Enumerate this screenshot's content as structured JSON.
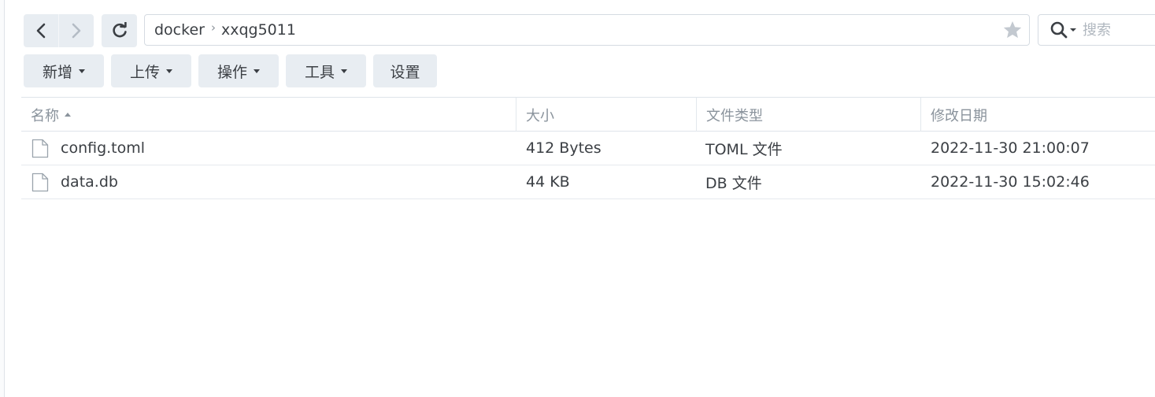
{
  "path": {
    "folder": "docker",
    "subfolder": "xxqg5011"
  },
  "search": {
    "placeholder": "搜索"
  },
  "toolbar": {
    "create": "新增",
    "upload": "上传",
    "action": "操作",
    "tools": "工具",
    "settings": "设置"
  },
  "columns": {
    "name": "名称",
    "size": "大小",
    "type": "文件类型",
    "modified": "修改日期"
  },
  "files": [
    {
      "name": "config.toml",
      "size": "412 Bytes",
      "type": "TOML 文件",
      "modified": "2022-11-30 21:00:07"
    },
    {
      "name": "data.db",
      "size": "44 KB",
      "type": "DB 文件",
      "modified": "2022-11-30 15:02:46"
    }
  ],
  "icons": {
    "back": "chevron-left-icon",
    "forward": "chevron-right-icon",
    "refresh": "refresh-icon",
    "favorite": "star-icon",
    "search": "search-icon",
    "file": "file-icon"
  },
  "colors": {
    "button_bg": "#e8edf2",
    "border": "#d5dbe2",
    "muted_text": "#8a939c",
    "star": "#c3c9d0"
  }
}
